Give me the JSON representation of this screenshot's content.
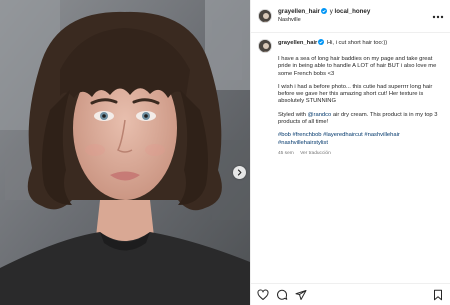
{
  "post": {
    "username": "grayellen_hair",
    "connector": "y",
    "collaborator": "local_honey",
    "location": "Nashville",
    "caption_first": "Hi, i cut short hair too:))",
    "paragraph1": "I have a sea of long hair baddies on my page and take great pride in being able to handle A LOT of hair BUT i also love me some French bobs <3",
    "paragraph2": "I wish i had a before photo... this cutie had superrrr long hair before we gave her this amazing short cut! Her texture is absolutely STUNNING",
    "styled_prefix": "Styled with ",
    "styled_mention": "@randco",
    "styled_suffix": " air dry cream. This product is in my top 3 products of all time!",
    "hashtags": "#bob #frenchbob #layeredhaircut #nashvillehair #nashvillehairstylist",
    "time_ago": "45 sem",
    "translate_label": "Ver traducción"
  },
  "icons": {
    "more": "more-horizontal-icon",
    "next": "chevron-right-icon",
    "like": "heart-icon",
    "comment": "comment-icon",
    "share": "send-icon",
    "save": "bookmark-icon",
    "verified": "verified-badge-icon"
  },
  "colors": {
    "link": "#00376b",
    "verified": "#0095f6",
    "muted": "#737373",
    "text": "#262626"
  }
}
